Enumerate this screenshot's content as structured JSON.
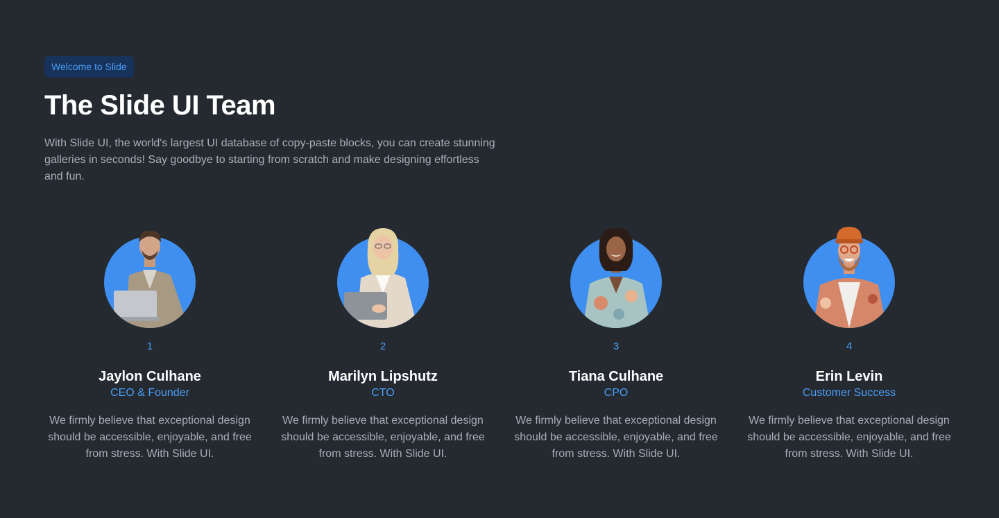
{
  "header": {
    "badge": "Welcome to Slide",
    "title": "The Slide UI Team",
    "intro": "With Slide UI, the world's largest UI database of copy-paste blocks, you can create stunning galleries in seconds! Say goodbye to starting from scratch and make designing effortless and fun."
  },
  "team": [
    {
      "number": "1",
      "name": "Jaylon Culhane",
      "role": "CEO & Founder",
      "bio": "We firmly believe that exceptional design should be accessible, enjoyable, and free from stress. With Slide UI."
    },
    {
      "number": "2",
      "name": "Marilyn Lipshutz",
      "role": "CTO",
      "bio": "We firmly believe that exceptional design should be accessible, enjoyable, and free from stress. With Slide UI."
    },
    {
      "number": "3",
      "name": "Tiana Culhane",
      "role": "CPO",
      "bio": "We firmly believe that exceptional design should be accessible, enjoyable, and free from stress. With Slide UI."
    },
    {
      "number": "4",
      "name": "Erin Levin",
      "role": "Customer Success",
      "bio": "We firmly believe that exceptional design should be accessible, enjoyable, and free from stress. With Slide UI."
    }
  ],
  "colors": {
    "background": "#252a31",
    "accent": "#4b9cf5",
    "avatar_circle": "#3f8ff0",
    "badge_bg": "#17335a"
  }
}
